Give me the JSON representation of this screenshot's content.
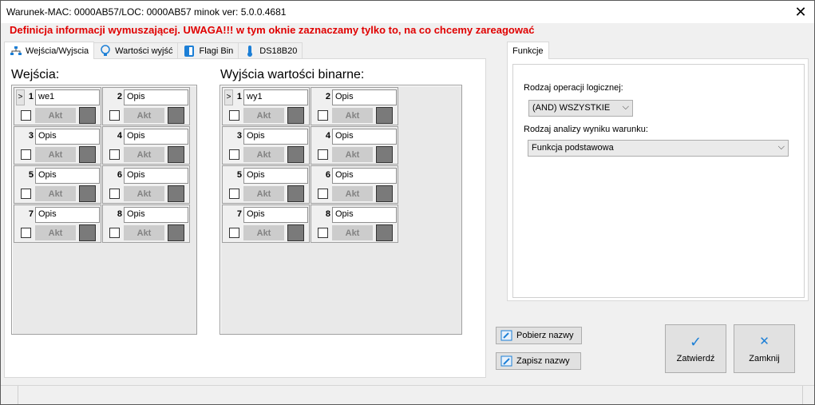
{
  "window": {
    "title": "Warunek-MAC: 0000AB57/LOC: 0000AB57 minok ver: 5.0.0.4681",
    "close_glyph": "✕"
  },
  "warning_text": "Definicja informacji wymuszającej. UWAGA!!! w tym oknie zaznaczamy tylko to, na co chcemy zareagować",
  "tabs": [
    {
      "label": "Wejścia/Wyjscia",
      "icon": "network-icon",
      "active": true
    },
    {
      "label": "Wartości wyjść",
      "icon": "lightbulb-icon",
      "active": false
    },
    {
      "label": "Flagi Bin",
      "icon": "flag-panel-icon",
      "active": false
    },
    {
      "label": "DS18B20",
      "icon": "thermometer-icon",
      "active": false
    }
  ],
  "inputs": {
    "title": "Wejścia:",
    "cells": [
      {
        "num": "1",
        "name": "we1",
        "akt": "Akt",
        "selector": ">"
      },
      {
        "num": "2",
        "name": "Opis",
        "akt": "Akt"
      },
      {
        "num": "3",
        "name": "Opis",
        "akt": "Akt"
      },
      {
        "num": "4",
        "name": "Opis",
        "akt": "Akt"
      },
      {
        "num": "5",
        "name": "Opis",
        "akt": "Akt"
      },
      {
        "num": "6",
        "name": "Opis",
        "akt": "Akt"
      },
      {
        "num": "7",
        "name": "Opis",
        "akt": "Akt"
      },
      {
        "num": "8",
        "name": "Opis",
        "akt": "Akt"
      }
    ]
  },
  "outputs": {
    "title": "Wyjścia wartości binarne:",
    "cells": [
      {
        "num": "1",
        "name": "wy1",
        "akt": "Akt",
        "selector": ">"
      },
      {
        "num": "2",
        "name": "Opis",
        "akt": "Akt"
      },
      {
        "num": "3",
        "name": "Opis",
        "akt": "Akt"
      },
      {
        "num": "4",
        "name": "Opis",
        "akt": "Akt"
      },
      {
        "num": "5",
        "name": "Opis",
        "akt": "Akt"
      },
      {
        "num": "6",
        "name": "Opis",
        "akt": "Akt"
      },
      {
        "num": "7",
        "name": "Opis",
        "akt": "Akt"
      },
      {
        "num": "8",
        "name": "Opis",
        "akt": "Akt"
      }
    ]
  },
  "functions": {
    "tab_label": "Funkcje",
    "logic_label": "Rodzaj operacji logicznej:",
    "logic_value": "(AND) WSZYSTKIE",
    "analysis_label": "Rodzaj analizy wyniku warunku:",
    "analysis_value": "Funkcja podstawowa"
  },
  "buttons": {
    "fetch_names": "Pobierz nazwy",
    "save_names": "Zapisz nazwy",
    "confirm": "Zatwierdź",
    "close": "Zamknij"
  },
  "colors": {
    "warning": "#e00000",
    "accent": "#1c7fd6",
    "indicator": "#7a7a7a"
  }
}
